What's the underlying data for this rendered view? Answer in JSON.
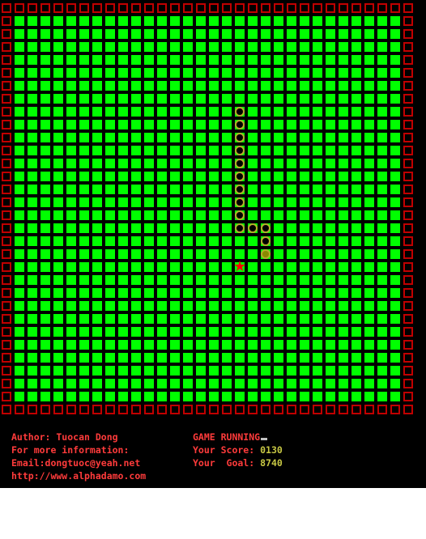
{
  "info": {
    "author": "Author: Tuocan Dong",
    "more_info": "For more information:",
    "email": "Email:dongtuoc@yeah.net",
    "url": "http://www.alphadamo.com",
    "status": "GAME RUNNING",
    "score_label": "Your Score:",
    "score_value": "0130",
    "goal_label": "Your  Goal:",
    "goal_value": "8740"
  },
  "game": {
    "colors": {
      "wall": "#c00000",
      "floor": "#00ff00",
      "snake": "#b5a82a",
      "head": "#8b8800",
      "food": "#ff0000"
    },
    "snake_segments": [
      [
        18,
        8
      ],
      [
        18,
        9
      ],
      [
        18,
        10
      ],
      [
        18,
        11
      ],
      [
        18,
        12
      ],
      [
        18,
        13
      ],
      [
        18,
        14
      ],
      [
        18,
        15
      ],
      [
        18,
        16
      ],
      [
        18,
        17
      ],
      [
        19,
        17
      ],
      [
        20,
        17
      ],
      [
        20,
        18
      ],
      [
        20,
        19
      ]
    ],
    "food": [
      18,
      20
    ],
    "food_icon": "★"
  }
}
